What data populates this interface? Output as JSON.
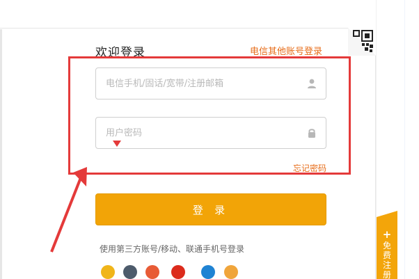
{
  "login": {
    "title": "欢迎登录",
    "other_account_link": "电信其他账号登录",
    "account_placeholder": "电信手机/固话/宽带/注册邮箱",
    "password_placeholder": "用户密码",
    "forgot_link": "忘记密码",
    "login_button": "登 录",
    "third_party_text": "使用第三方账号/移动、联通手机号登录"
  },
  "register_tab": {
    "label": "免费注册"
  },
  "colors": {
    "accent_orange": "#f2a407",
    "link_orange": "#e76d1a",
    "annotation_red": "#e43a3a"
  },
  "icons": [
    "qr-code-icon",
    "user-icon",
    "lock-icon",
    "plus-icon",
    "social-icons"
  ]
}
